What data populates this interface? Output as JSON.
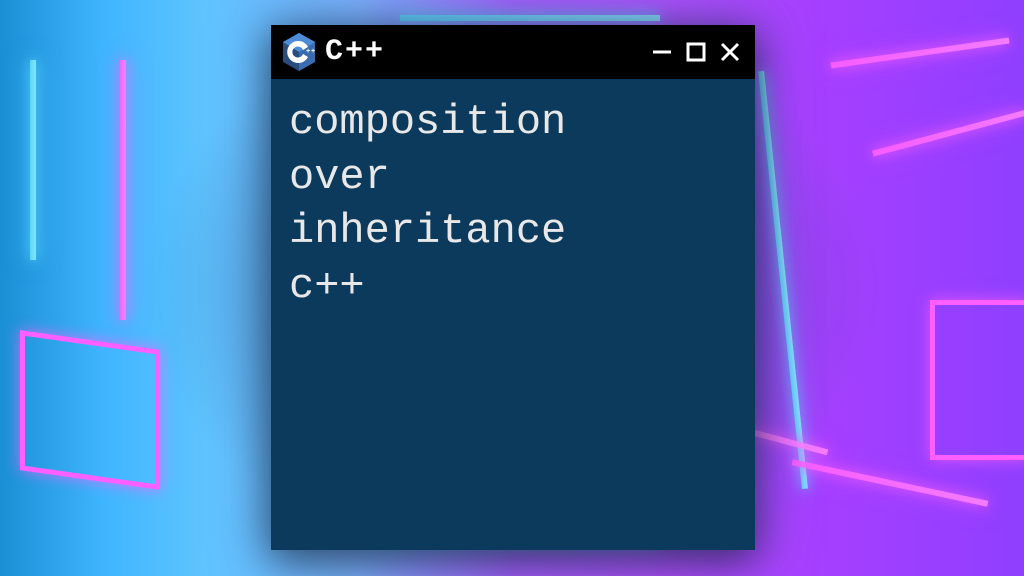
{
  "window": {
    "title": "C++",
    "content": {
      "line1": "composition",
      "line2": "over",
      "line3": "inheritance",
      "line4": "c++"
    }
  },
  "controls": {
    "minimize_label": "Minimize",
    "maximize_label": "Maximize",
    "close_label": "Close"
  }
}
